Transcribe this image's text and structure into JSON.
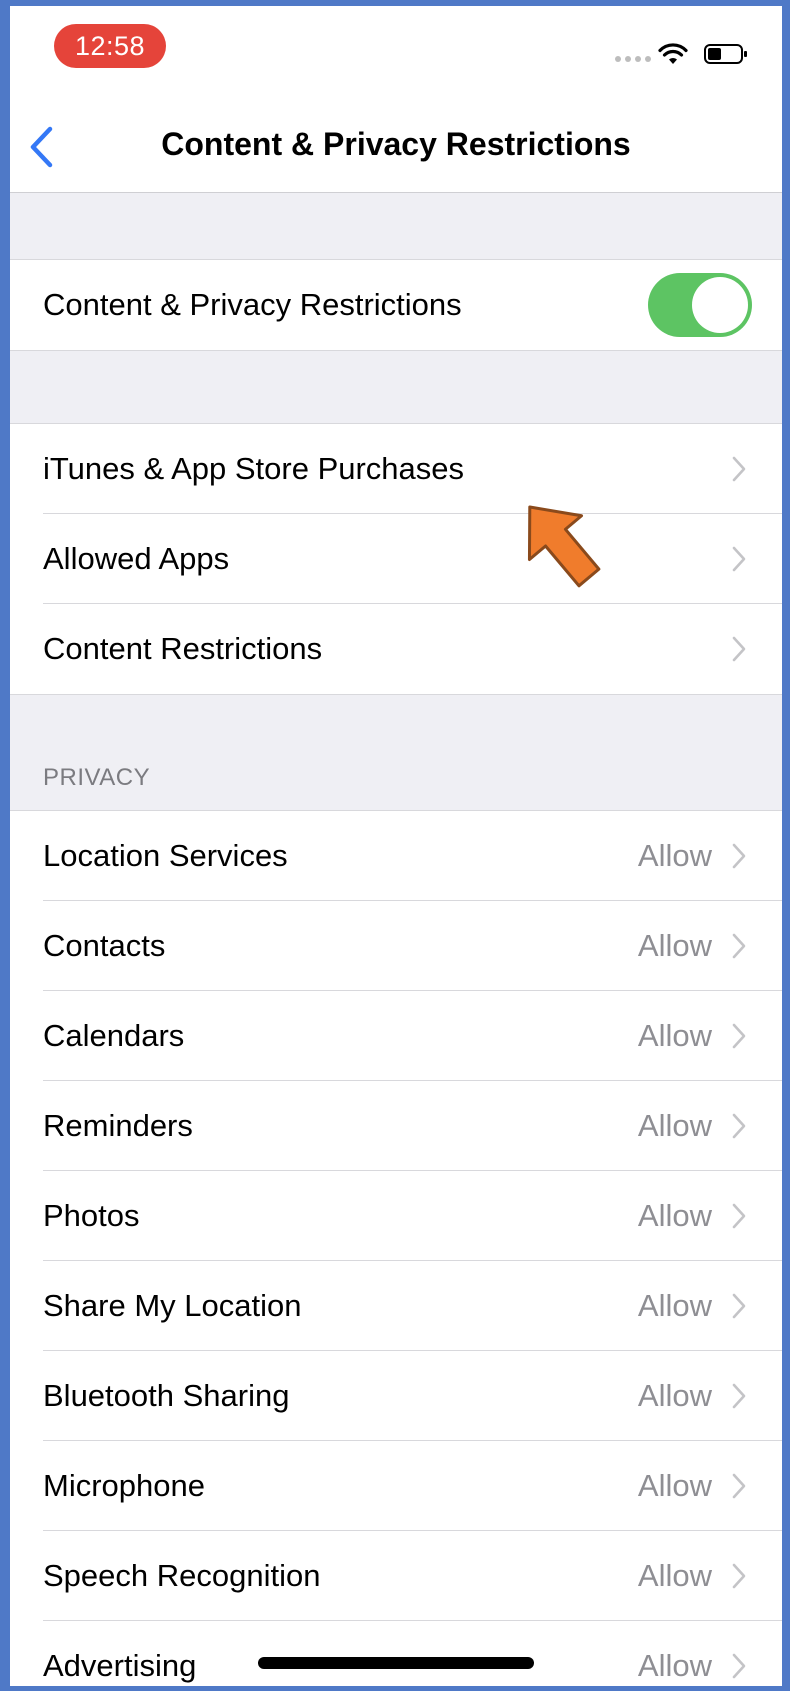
{
  "status": {
    "time": "12:58"
  },
  "nav": {
    "title": "Content & Privacy Restrictions"
  },
  "main_toggle": {
    "label": "Content & Privacy Restrictions",
    "on": true
  },
  "store_group": [
    {
      "label": "iTunes & App Store Purchases"
    },
    {
      "label": "Allowed Apps"
    },
    {
      "label": "Content Restrictions"
    }
  ],
  "privacy": {
    "header": "PRIVACY",
    "items": [
      {
        "label": "Location Services",
        "value": "Allow"
      },
      {
        "label": "Contacts",
        "value": "Allow"
      },
      {
        "label": "Calendars",
        "value": "Allow"
      },
      {
        "label": "Reminders",
        "value": "Allow"
      },
      {
        "label": "Photos",
        "value": "Allow"
      },
      {
        "label": "Share My Location",
        "value": "Allow"
      },
      {
        "label": "Bluetooth Sharing",
        "value": "Allow"
      },
      {
        "label": "Microphone",
        "value": "Allow"
      },
      {
        "label": "Speech Recognition",
        "value": "Allow"
      },
      {
        "label": "Advertising",
        "value": "Allow"
      }
    ]
  },
  "colors": {
    "accent": "#3478f6",
    "toggle_on": "#5dc463",
    "time_pill": "#e5443a",
    "annotation_arrow": "#f07c2c"
  }
}
